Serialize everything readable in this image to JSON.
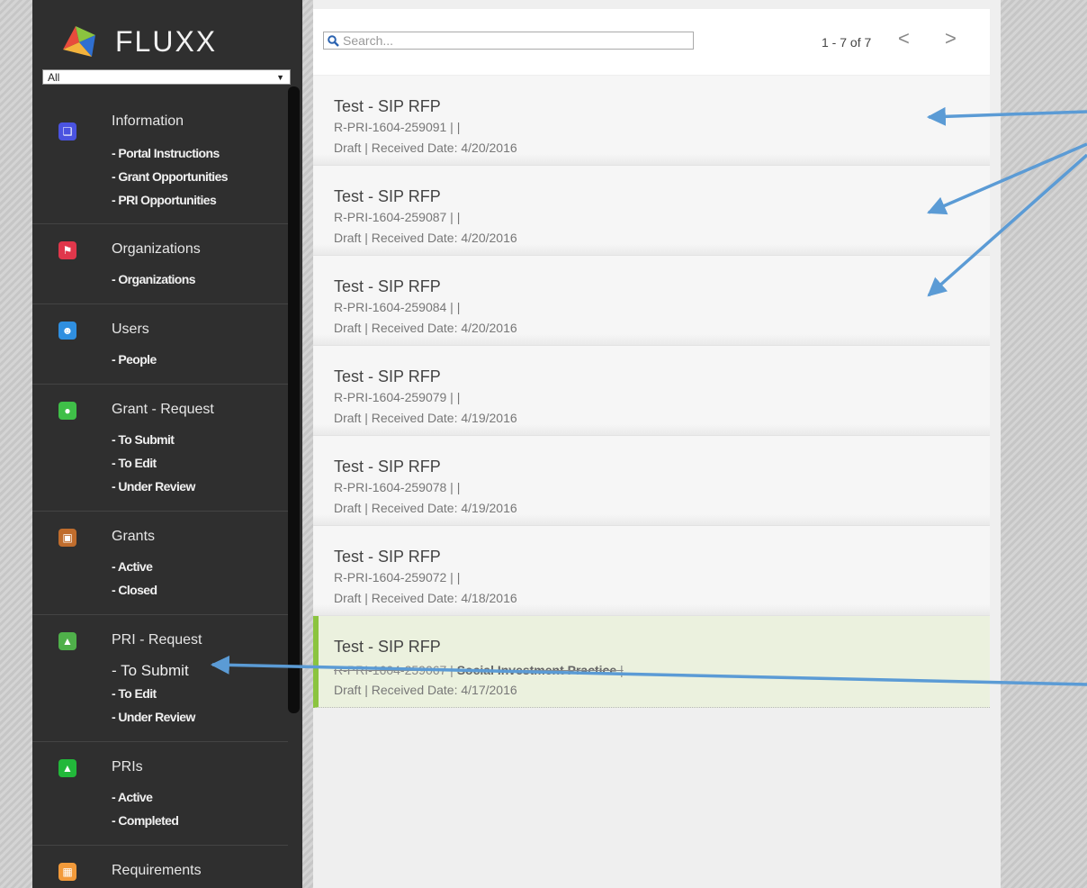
{
  "app": {
    "name": "FLUXX"
  },
  "filter": {
    "value": "All"
  },
  "sidebar": {
    "sections": [
      {
        "title": "Information",
        "icon": "information-icon",
        "color": "#4a53e0",
        "links": [
          "- Portal Instructions",
          "- Grant Opportunities",
          "- PRI Opportunities"
        ]
      },
      {
        "title": "Organizations",
        "icon": "organizations-icon",
        "color": "#e0374b",
        "links": [
          "- Organizations"
        ]
      },
      {
        "title": "Users",
        "icon": "users-icon",
        "color": "#2f8fe0",
        "links": [
          "- People"
        ]
      },
      {
        "title": "Grant - Request",
        "icon": "grant-request-icon",
        "color": "#3fbf48",
        "links": [
          "- To Submit",
          "- To Edit",
          "- Under Review"
        ]
      },
      {
        "title": "Grants",
        "icon": "grants-icon",
        "color": "#c06d2d",
        "links": [
          "- Active",
          "- Closed"
        ]
      },
      {
        "title": "PRI - Request",
        "icon": "pri-request-icon",
        "color": "#4fb04a",
        "links": [
          "- To Submit",
          "- To Edit",
          "- Under Review"
        ]
      },
      {
        "title": "PRIs",
        "icon": "pris-icon",
        "color": "#22b83a",
        "links": [
          "- Active",
          "- Completed"
        ]
      },
      {
        "title": "Requirements",
        "icon": "requirements-icon",
        "color": "#f29a3a",
        "links": []
      }
    ]
  },
  "search": {
    "placeholder": "Search..."
  },
  "pager": {
    "text": "1 - 7 of 7",
    "prev": "<",
    "next": ">"
  },
  "requests": [
    {
      "title": "Test - SIP RFP",
      "id_line": "R-PRI-1604-259091 |  |",
      "status_line": "Draft  | Received Date: 4/20/2016"
    },
    {
      "title": "Test - SIP RFP",
      "id_line": "R-PRI-1604-259087 |  |",
      "status_line": "Draft  | Received Date: 4/20/2016"
    },
    {
      "title": "Test - SIP RFP",
      "id_line": "R-PRI-1604-259084 |  |",
      "status_line": "Draft  | Received Date: 4/20/2016"
    },
    {
      "title": "Test - SIP RFP",
      "id_line": "R-PRI-1604-259079 |  |",
      "status_line": "Draft  | Received Date: 4/19/2016"
    },
    {
      "title": "Test - SIP RFP",
      "id_line": "R-PRI-1604-259078 |  |",
      "status_line": "Draft  | Received Date: 4/19/2016"
    },
    {
      "title": "Test - SIP RFP",
      "id_line": "R-PRI-1604-259072 |  |",
      "status_line": "Draft  | Received Date: 4/18/2016"
    },
    {
      "title": "Test - SIP RFP",
      "id_line": "R-PRI-1604-259067 | ",
      "program": "Social Investment Practice",
      "id_suffix": " |",
      "status_line": "Draft  | Received Date: 4/17/2016",
      "selected": true
    }
  ],
  "annotation_color": "#5b9bd5"
}
